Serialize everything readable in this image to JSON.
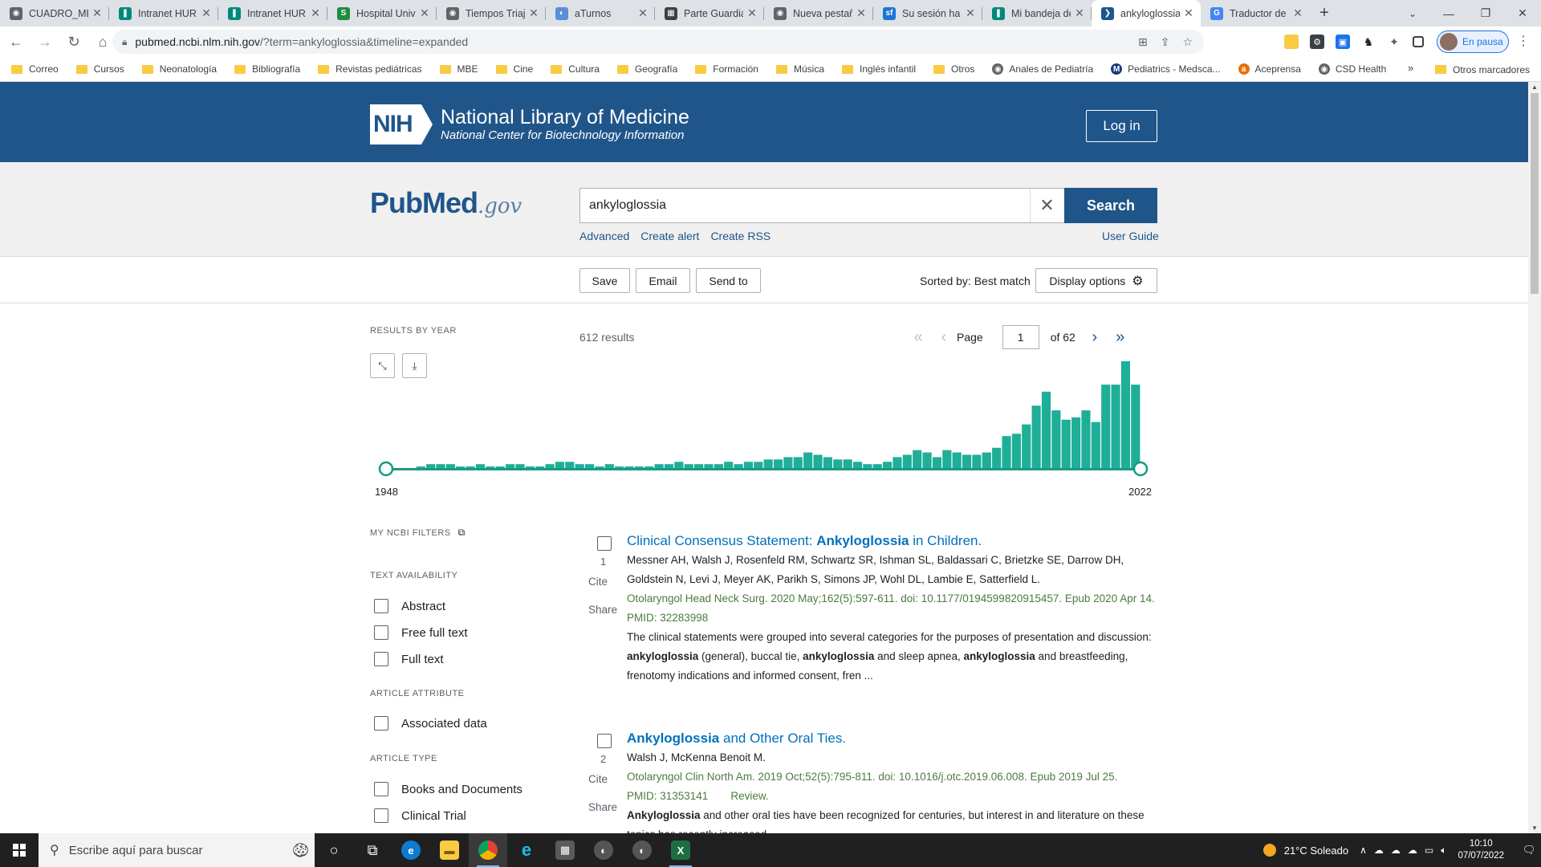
{
  "browser": {
    "tabs": [
      {
        "label": "CUADRO_ME",
        "favicon_color": "#5f6368",
        "favicon_glyph": "◉"
      },
      {
        "label": "Intranet HUR",
        "favicon_color": "#00897b",
        "favicon_glyph": "❚"
      },
      {
        "label": "Intranet HUR",
        "favicon_color": "#00897b",
        "favicon_glyph": "❚"
      },
      {
        "label": "Hospital Univ",
        "favicon_color": "#1e8e3e",
        "favicon_glyph": "S"
      },
      {
        "label": "Tiempos Triaj",
        "favicon_color": "#5f6368",
        "favicon_glyph": "◉"
      },
      {
        "label": "aTurnos",
        "favicon_color": "#5b8fd8",
        "favicon_glyph": "◐"
      },
      {
        "label": "Parte Guardia",
        "favicon_color": "#3c4043",
        "favicon_glyph": "▦"
      },
      {
        "label": "Nueva pestañ",
        "favicon_color": "#5f6368",
        "favicon_glyph": "◉"
      },
      {
        "label": "Su sesión ha c",
        "favicon_color": "#1976d2",
        "favicon_glyph": "sf"
      },
      {
        "label": "Mi bandeja de",
        "favicon_color": "#00897b",
        "favicon_glyph": "❚"
      },
      {
        "label": "ankyloglossia",
        "favicon_color": "#20558a",
        "favicon_glyph": "❯"
      },
      {
        "label": "Traductor de",
        "favicon_color": "#4285f4",
        "favicon_glyph": "G"
      }
    ],
    "url_host": "pubmed.ncbi.nlm.nih.gov",
    "url_path": "/?term=ankyloglossia&timeline=expanded",
    "profile_label": "En pausa",
    "bookmarks": [
      {
        "label": "Correo",
        "type": "folder"
      },
      {
        "label": "Cursos",
        "type": "folder"
      },
      {
        "label": "Neonatología",
        "type": "folder"
      },
      {
        "label": "Bibliografía",
        "type": "folder"
      },
      {
        "label": "Revistas pediátricas",
        "type": "folder"
      },
      {
        "label": "MBE",
        "type": "folder"
      },
      {
        "label": "Cine",
        "type": "folder"
      },
      {
        "label": "Cultura",
        "type": "folder"
      },
      {
        "label": "Geografía",
        "type": "folder"
      },
      {
        "label": "Formación",
        "type": "folder"
      },
      {
        "label": "Música",
        "type": "folder"
      },
      {
        "label": "Inglés infantil",
        "type": "folder"
      },
      {
        "label": "Otros",
        "type": "folder"
      },
      {
        "label": "Anales de Pediatría",
        "type": "site",
        "color": "#5f6368",
        "glyph": "◉"
      },
      {
        "label": "Pediatrics - Medsca...",
        "type": "site",
        "color": "#1a3a7a",
        "glyph": "M"
      },
      {
        "label": "Aceprensa",
        "type": "site",
        "color": "#e8710a",
        "glyph": "a"
      },
      {
        "label": "CSD Health",
        "type": "site",
        "color": "#5f6368",
        "glyph": "◉"
      }
    ],
    "bookmarks_more": "»",
    "other_bookmarks": "Otros marcadores"
  },
  "header": {
    "nih_badge": "NIH",
    "org_title": "National Library of Medicine",
    "org_subtitle": "National Center for Biotechnology Information",
    "login_label": "Log in"
  },
  "search": {
    "logo_pub": "Pub",
    "logo_med": "Med",
    "logo_gov": ".gov",
    "query": "ankyloglossia",
    "button_label": "Search",
    "links": [
      "Advanced",
      "Create alert",
      "Create RSS"
    ],
    "user_guide": "User Guide"
  },
  "actions": {
    "save": "Save",
    "email": "Email",
    "send_to": "Send to",
    "sorted_by": "Sorted by: Best match",
    "display_options": "Display options"
  },
  "results_meta": {
    "results_by_year": "RESULTS BY YEAR",
    "count": "612 results",
    "page_label": "Page",
    "page_value": "1",
    "of_pages": "of 62"
  },
  "chart_data": {
    "type": "bar",
    "x_start": 1948,
    "x_end": 2022,
    "start_label": "1948",
    "end_label": "2022",
    "values": [
      0,
      0,
      0,
      1,
      2,
      2,
      2,
      1,
      1,
      2,
      1,
      1,
      2,
      2,
      1,
      1,
      2,
      3,
      3,
      2,
      2,
      1,
      2,
      1,
      1,
      1,
      1,
      2,
      2,
      3,
      2,
      2,
      2,
      2,
      3,
      2,
      3,
      3,
      4,
      4,
      5,
      5,
      7,
      6,
      5,
      4,
      4,
      3,
      2,
      2,
      3,
      5,
      6,
      8,
      7,
      5,
      8,
      7,
      6,
      6,
      7,
      9,
      14,
      15,
      19,
      27,
      33,
      25,
      21,
      22,
      25,
      20,
      36,
      36,
      46,
      36
    ],
    "ylim": [
      0,
      46
    ],
    "color": "#1fae98"
  },
  "filters": {
    "my_ncbi": "MY NCBI FILTERS",
    "text_availability": "TEXT AVAILABILITY",
    "ta_items": [
      "Abstract",
      "Free full text",
      "Full text"
    ],
    "article_attribute": "ARTICLE ATTRIBUTE",
    "aa_items": [
      "Associated data"
    ],
    "article_type": "ARTICLE TYPE",
    "at_items": [
      "Books and Documents",
      "Clinical Trial"
    ]
  },
  "results": [
    {
      "num": "1",
      "title_pre": "Clinical Consensus Statement: ",
      "title_bold": "Ankyloglossia",
      "title_post": " in Children.",
      "authors": "Messner AH, Walsh J, Rosenfeld RM, Schwartz SR, Ishman SL, Baldassari C, Brietzke SE, Darrow DH, Goldstein N, Levi J, Meyer AK, Parikh S, Simons JP, Wohl DL, Lambie E, Satterfield L.",
      "journal": "Otolaryngol Head Neck Surg. 2020 May;162(5):597-611. doi: 10.1177/0194599820915457. Epub 2020 Apr 14.",
      "pmid": "PMID: 32283998",
      "review": "",
      "snippet_parts": [
        "The clinical statements were grouped into several categories for the purposes of presentation and discussion: ",
        "ankyloglossia",
        " (general), buccal tie, ",
        "ankyloglossia",
        " and sleep apnea, ",
        "ankyloglossia",
        " and breastfeeding, frenotomy indications and informed consent, fren ..."
      ],
      "cite": "Cite",
      "share": "Share"
    },
    {
      "num": "2",
      "title_pre": "",
      "title_bold": "Ankyloglossia",
      "title_post": " and Other Oral Ties.",
      "authors": "Walsh J, McKenna Benoit M.",
      "journal": "Otolaryngol Clin North Am. 2019 Oct;52(5):795-811. doi: 10.1016/j.otc.2019.06.008. Epub 2019 Jul 25.",
      "pmid": "PMID: 31353141",
      "review": "Review.",
      "snippet_parts": [
        "",
        "Ankyloglossia",
        " and other oral ties have been recognized for centuries, but interest in and literature on these topics has recently increased."
      ],
      "cite": "Cite",
      "share": "Share"
    }
  ],
  "taskbar": {
    "search_placeholder": "Escribe aquí para buscar",
    "weather": "21°C Soleado",
    "time": "10:10",
    "date": "07/07/2022"
  }
}
